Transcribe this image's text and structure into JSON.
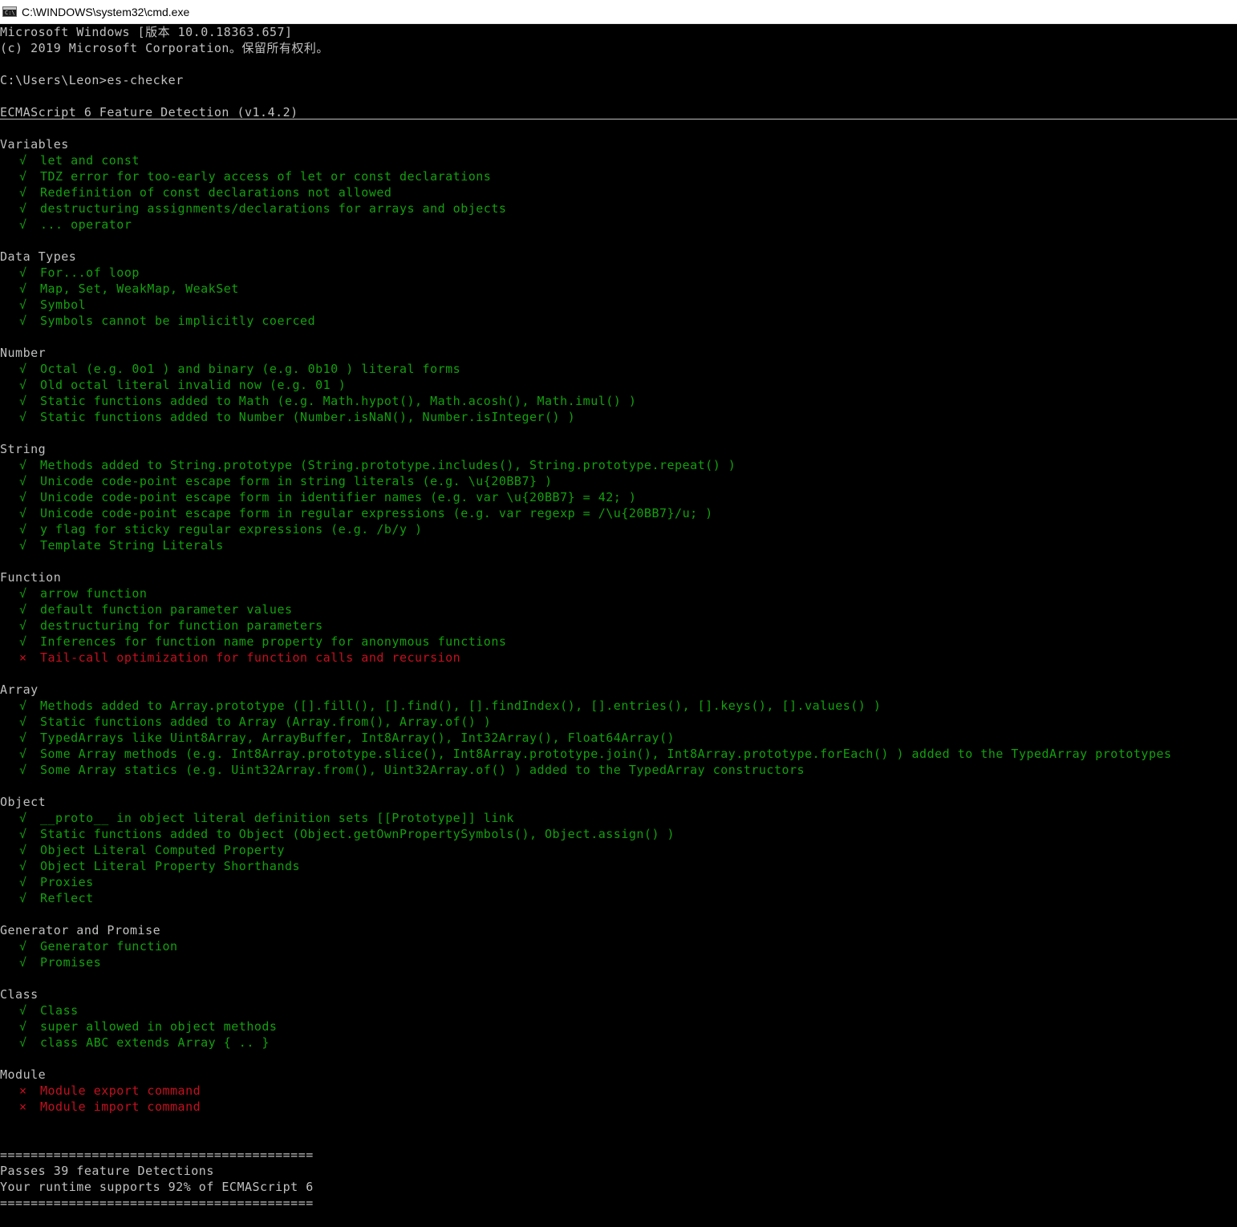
{
  "window": {
    "title": "C:\\WINDOWS\\system32\\cmd.exe",
    "icon": "cmd-icon"
  },
  "colors": {
    "background": "#000000",
    "text": "#c0c0c0",
    "pass": "#13a10e",
    "fail": "#c50f1f"
  },
  "console": {
    "banner_line1": "Microsoft Windows [版本 10.0.18363.657]",
    "banner_line2": "(c) 2019 Microsoft Corporation。保留所有权利。",
    "prompt": "C:\\Users\\Leon>es-checker",
    "heading": "ECMAScript 6 Feature Detection (v1.4.2)",
    "pass_mark": "√",
    "fail_mark": "×",
    "sections": [
      {
        "name": "Variables",
        "items": [
          {
            "text": "let and const",
            "status": "pass"
          },
          {
            "text": "TDZ error for too-early access of let or const declarations",
            "status": "pass"
          },
          {
            "text": "Redefinition of const declarations not allowed",
            "status": "pass"
          },
          {
            "text": "destructuring assignments/declarations for arrays and objects",
            "status": "pass"
          },
          {
            "text": "... operator",
            "status": "pass"
          }
        ]
      },
      {
        "name": "Data Types",
        "items": [
          {
            "text": "For...of loop",
            "status": "pass"
          },
          {
            "text": "Map, Set, WeakMap, WeakSet",
            "status": "pass"
          },
          {
            "text": "Symbol",
            "status": "pass"
          },
          {
            "text": "Symbols cannot be implicitly coerced",
            "status": "pass"
          }
        ]
      },
      {
        "name": "Number",
        "items": [
          {
            "text": "Octal (e.g. 0o1 ) and binary (e.g. 0b10 ) literal forms",
            "status": "pass"
          },
          {
            "text": "Old octal literal invalid now (e.g. 01 )",
            "status": "pass"
          },
          {
            "text": "Static functions added to Math (e.g. Math.hypot(), Math.acosh(), Math.imul() )",
            "status": "pass"
          },
          {
            "text": "Static functions added to Number (Number.isNaN(), Number.isInteger() )",
            "status": "pass"
          }
        ]
      },
      {
        "name": "String",
        "items": [
          {
            "text": "Methods added to String.prototype (String.prototype.includes(), String.prototype.repeat() )",
            "status": "pass"
          },
          {
            "text": "Unicode code-point escape form in string literals (e.g. \\u{20BB7} )",
            "status": "pass"
          },
          {
            "text": "Unicode code-point escape form in identifier names (e.g. var \\u{20BB7} = 42; )",
            "status": "pass"
          },
          {
            "text": "Unicode code-point escape form in regular expressions (e.g. var regexp = /\\u{20BB7}/u; )",
            "status": "pass"
          },
          {
            "text": "y flag for sticky regular expressions (e.g. /b/y )",
            "status": "pass"
          },
          {
            "text": "Template String Literals",
            "status": "pass"
          }
        ]
      },
      {
        "name": "Function",
        "items": [
          {
            "text": "arrow function",
            "status": "pass"
          },
          {
            "text": "default function parameter values",
            "status": "pass"
          },
          {
            "text": "destructuring for function parameters",
            "status": "pass"
          },
          {
            "text": "Inferences for function name property for anonymous functions",
            "status": "pass"
          },
          {
            "text": "Tail-call optimization for function calls and recursion",
            "status": "fail"
          }
        ]
      },
      {
        "name": "Array",
        "items": [
          {
            "text": "Methods added to Array.prototype ([].fill(), [].find(), [].findIndex(), [].entries(), [].keys(), [].values() )",
            "status": "pass"
          },
          {
            "text": "Static functions added to Array (Array.from(), Array.of() )",
            "status": "pass"
          },
          {
            "text": "TypedArrays like Uint8Array, ArrayBuffer, Int8Array(), Int32Array(), Float64Array()",
            "status": "pass"
          },
          {
            "text": "Some Array methods (e.g. Int8Array.prototype.slice(), Int8Array.prototype.join(), Int8Array.prototype.forEach() ) added to the TypedArray prototypes",
            "status": "pass"
          },
          {
            "text": "Some Array statics (e.g. Uint32Array.from(), Uint32Array.of() ) added to the TypedArray constructors",
            "status": "pass"
          }
        ]
      },
      {
        "name": "Object",
        "items": [
          {
            "text": "__proto__ in object literal definition sets [[Prototype]] link",
            "status": "pass"
          },
          {
            "text": "Static functions added to Object (Object.getOwnPropertySymbols(), Object.assign() )",
            "status": "pass"
          },
          {
            "text": "Object Literal Computed Property",
            "status": "pass"
          },
          {
            "text": "Object Literal Property Shorthands",
            "status": "pass"
          },
          {
            "text": "Proxies",
            "status": "pass"
          },
          {
            "text": "Reflect",
            "status": "pass"
          }
        ]
      },
      {
        "name": "Generator and Promise",
        "items": [
          {
            "text": "Generator function",
            "status": "pass"
          },
          {
            "text": "Promises",
            "status": "pass"
          }
        ]
      },
      {
        "name": "Class",
        "items": [
          {
            "text": "Class",
            "status": "pass"
          },
          {
            "text": "super allowed in object methods",
            "status": "pass"
          },
          {
            "text": "class ABC extends Array { .. }",
            "status": "pass"
          }
        ]
      },
      {
        "name": "Module",
        "items": [
          {
            "text": "Module export command",
            "status": "fail"
          },
          {
            "text": "Module import command",
            "status": "fail"
          }
        ]
      }
    ],
    "separator": "=========================================",
    "summary_line1": "Passes 39 feature Detections",
    "summary_line2": "Your runtime supports 92% of ECMAScript 6"
  }
}
